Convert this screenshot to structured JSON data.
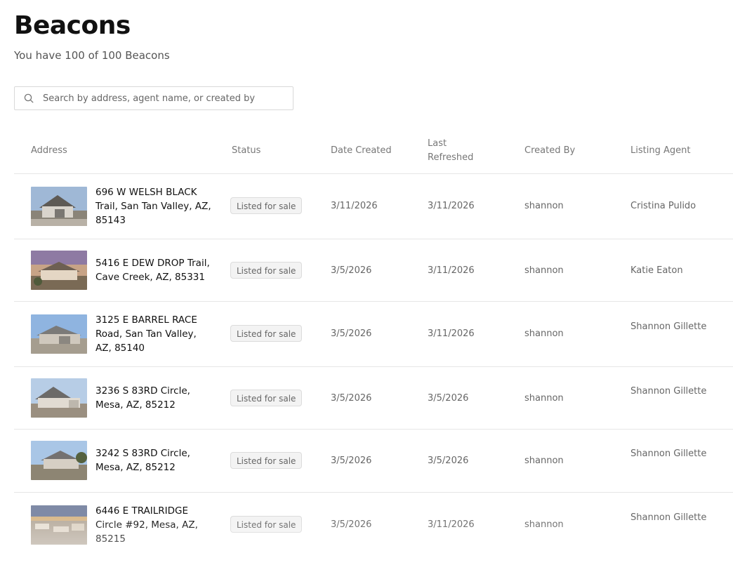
{
  "header": {
    "title": "Beacons",
    "subtitle": "You have 100 of 100 Beacons"
  },
  "search": {
    "placeholder": "Search by address, agent name, or created by",
    "value": "",
    "icon": "search-icon"
  },
  "table": {
    "columns": {
      "address": "Address",
      "status": "Status",
      "date_created": "Date Created",
      "last_refreshed": "Last Refreshed",
      "created_by": "Created By",
      "listing_agent": "Listing Agent"
    },
    "rows": [
      {
        "address": "696 W WELSH BLACK Trail, San Tan Valley, AZ, 85143",
        "status": "Listed for sale",
        "date_created": "3/11/2026",
        "last_refreshed": "3/11/2026",
        "created_by": "shannon",
        "listing_agent": "Cristina Pulido"
      },
      {
        "address": "5416 E DEW DROP Trail, Cave Creek, AZ, 85331",
        "status": "Listed for sale",
        "date_created": "3/5/2026",
        "last_refreshed": "3/11/2026",
        "created_by": "shannon",
        "listing_agent": "Katie Eaton"
      },
      {
        "address": "3125 E BARREL RACE Road, San Tan Valley, AZ, 85140",
        "status": "Listed for sale",
        "date_created": "3/5/2026",
        "last_refreshed": "3/11/2026",
        "created_by": "shannon",
        "listing_agent": "Shannon Gillette"
      },
      {
        "address": "3236 S 83RD Circle, Mesa, AZ, 85212",
        "status": "Listed for sale",
        "date_created": "3/5/2026",
        "last_refreshed": "3/5/2026",
        "created_by": "shannon",
        "listing_agent": "Shannon Gillette"
      },
      {
        "address": "3242 S 83RD Circle, Mesa, AZ, 85212",
        "status": "Listed for sale",
        "date_created": "3/5/2026",
        "last_refreshed": "3/5/2026",
        "created_by": "shannon",
        "listing_agent": "Shannon Gillette"
      },
      {
        "address": "6446 E TRAILRIDGE Circle #92, Mesa, AZ, 85215",
        "status": "Listed for sale",
        "date_created": "3/5/2026",
        "last_refreshed": "3/11/2026",
        "created_by": "shannon",
        "listing_agent": "Shannon Gillette"
      }
    ]
  },
  "colors": {
    "badge_bg": "#f3f3f3",
    "border": "#e6e6e6",
    "text_muted": "#666666"
  }
}
